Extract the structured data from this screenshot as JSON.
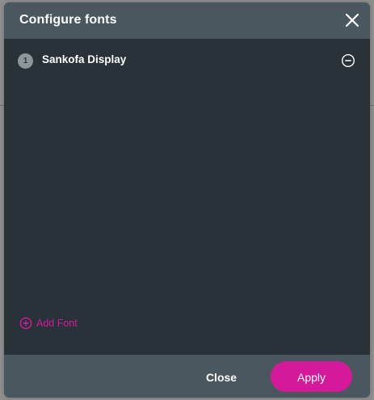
{
  "dialog": {
    "title": "Configure fonts",
    "close_icon": "close-icon"
  },
  "fonts": [
    {
      "index": "1",
      "name": "Sankofa Display",
      "remove_icon": "minus-circle-icon"
    }
  ],
  "add_font": {
    "label": "Add Font",
    "icon": "plus-circle-icon"
  },
  "footer": {
    "close_label": "Close",
    "apply_label": "Apply"
  },
  "colors": {
    "accent": "#d41a9b",
    "header_bg": "#4a575e",
    "body_bg": "#283238"
  }
}
